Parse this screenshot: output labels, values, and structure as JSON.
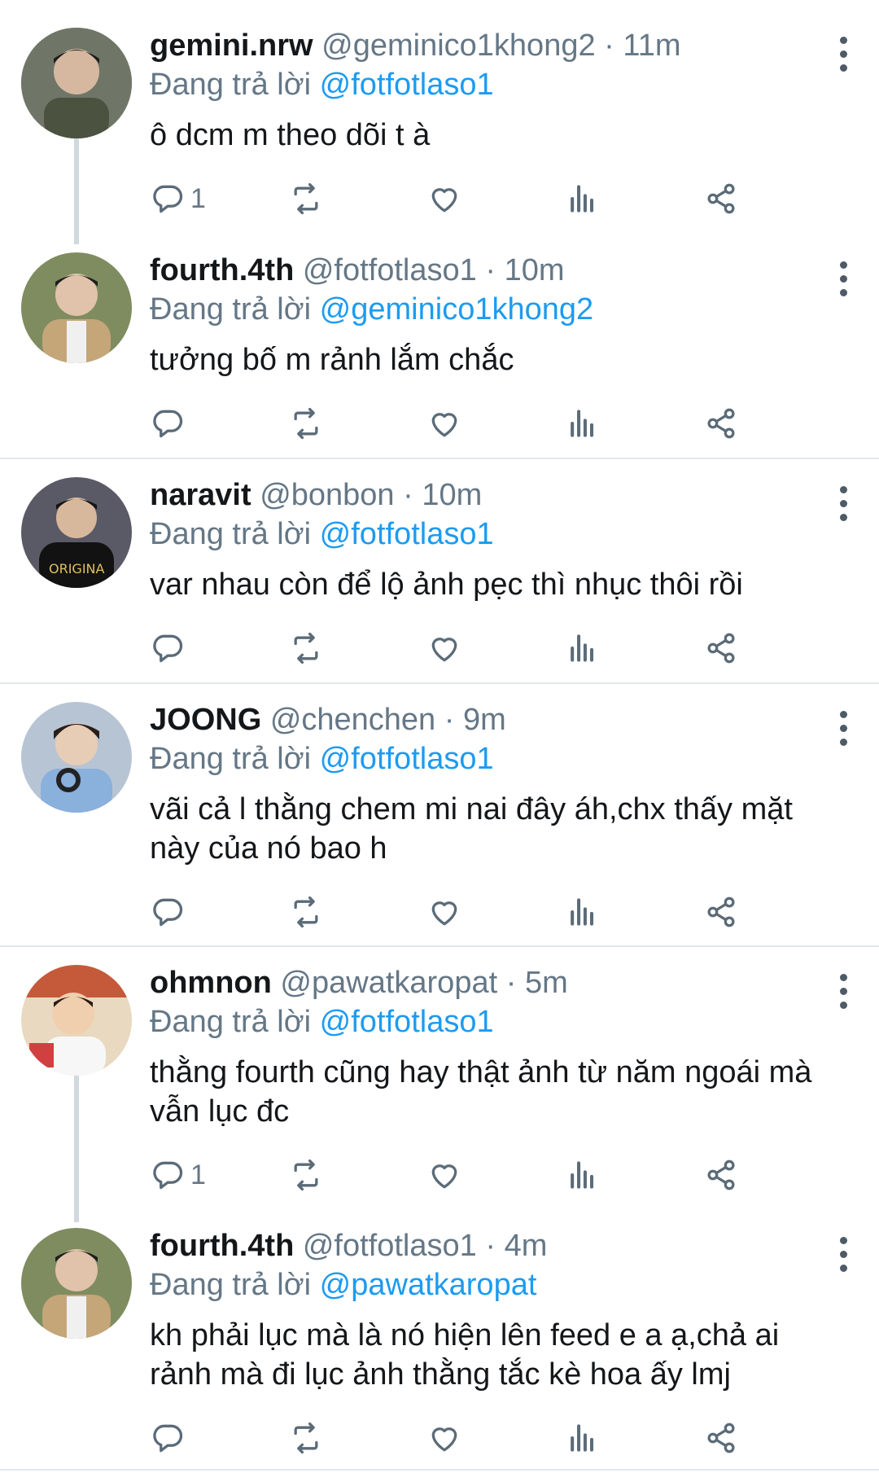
{
  "tweets": [
    {
      "name": "gemini.nrw",
      "handle": "@geminico1khong2",
      "dot": "·",
      "time": "11m",
      "reply_prefix": "Đang trả lời",
      "reply_to": "@fotfotlaso1",
      "text": "ô dcm m theo dõi t à",
      "reply_count": "1",
      "avatar_color": "#6b6f60"
    },
    {
      "name": "fourth.4th",
      "handle": "@fotfotlaso1",
      "dot": "·",
      "time": "10m",
      "reply_prefix": "Đang trả lời",
      "reply_to": "@geminico1khong2",
      "text": "tưởng bố m rảnh lắm chắc",
      "reply_count": "",
      "avatar_color": "#7d8a5a"
    },
    {
      "name": "naravit",
      "handle": "@bonbon",
      "dot": "·",
      "time": "10m",
      "reply_prefix": "Đang trả lời",
      "reply_to": "@fotfotlaso1",
      "text": "var nhau còn để lộ ảnh pẹc thì nhục thôi rồi",
      "reply_count": "",
      "avatar_color": "#2c2c2c"
    },
    {
      "name": "JOONG",
      "handle": "@chenchen",
      "dot": "·",
      "time": "9m",
      "reply_prefix": "Đang trả lời",
      "reply_to": "@fotfotlaso1",
      "text": "vãi cả l thằng chem mi nai đây áh,chx thấy mặt này của nó bao h",
      "reply_count": "",
      "avatar_color": "#8fa7c4"
    },
    {
      "name": "ohmnon",
      "handle": "@pawatkaropat",
      "dot": "·",
      "time": "5m",
      "reply_prefix": "Đang trả lời",
      "reply_to": "@fotfotlaso1",
      "text": "thằng fourth cũng hay thật ảnh từ năm ngoái mà vẫn lục đc",
      "reply_count": "1",
      "avatar_color": "#c9a27a"
    },
    {
      "name": "fourth.4th",
      "handle": "@fotfotlaso1",
      "dot": "·",
      "time": "4m",
      "reply_prefix": "Đang trả lời",
      "reply_to": "@pawatkaropat",
      "text": "kh phải lục mà là nó hiện lên feed e a ạ,chả ai rảnh mà đi lục ảnh thằng tắc kè hoa ấy lmj",
      "reply_count": "",
      "avatar_color": "#7d8a5a"
    }
  ],
  "icons": {
    "reply": "reply-icon",
    "retweet": "retweet-icon",
    "like": "heart-icon",
    "analytics": "analytics-icon",
    "share": "share-icon",
    "more": "more-vertical-icon"
  },
  "colors": {
    "mention": "#1d9bf0",
    "muted": "#657786",
    "text": "#14171a",
    "thread_line": "#cfd9de",
    "separator": "#e1e8ed"
  }
}
